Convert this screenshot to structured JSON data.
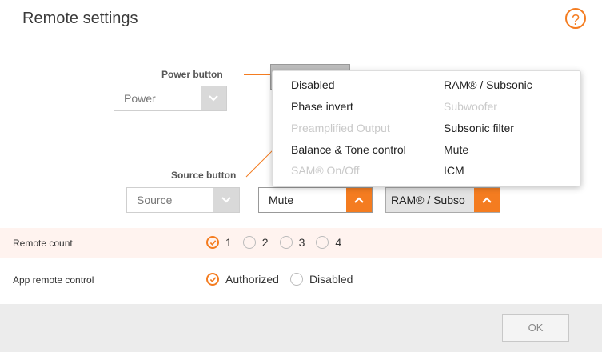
{
  "page": {
    "title": "Remote settings",
    "help_icon": "?"
  },
  "power": {
    "label": "Power button",
    "select_value": "Power"
  },
  "source": {
    "label": "Source button",
    "select_value": "Source",
    "second_select_value": "Mute",
    "third_select_value": "RAM® / Subso"
  },
  "dropdown": {
    "left_items": [
      {
        "label": "Disabled",
        "disabled": false
      },
      {
        "label": "Phase invert",
        "disabled": false
      },
      {
        "label": "Preamplified Output",
        "disabled": true
      },
      {
        "label": "Balance & Tone control",
        "disabled": false
      },
      {
        "label": "SAM® On/Off",
        "disabled": true
      }
    ],
    "right_items": [
      {
        "label": "RAM® / Subsonic",
        "disabled": false
      },
      {
        "label": "Subwoofer",
        "disabled": true
      },
      {
        "label": "Subsonic filter",
        "disabled": false
      },
      {
        "label": "Mute",
        "disabled": false
      },
      {
        "label": "ICM",
        "disabled": false
      }
    ]
  },
  "remote_count": {
    "label": "Remote count",
    "options": [
      "1",
      "2",
      "3",
      "4"
    ],
    "selected": "1"
  },
  "app_remote": {
    "label": "App remote control",
    "options": [
      "Authorized",
      "Disabled"
    ],
    "selected": "Authorized"
  },
  "footer": {
    "ok_label": "OK"
  },
  "colors": {
    "accent": "#f47c20",
    "row_highlight": "#fff3ef",
    "footer_bg": "#ececec"
  }
}
